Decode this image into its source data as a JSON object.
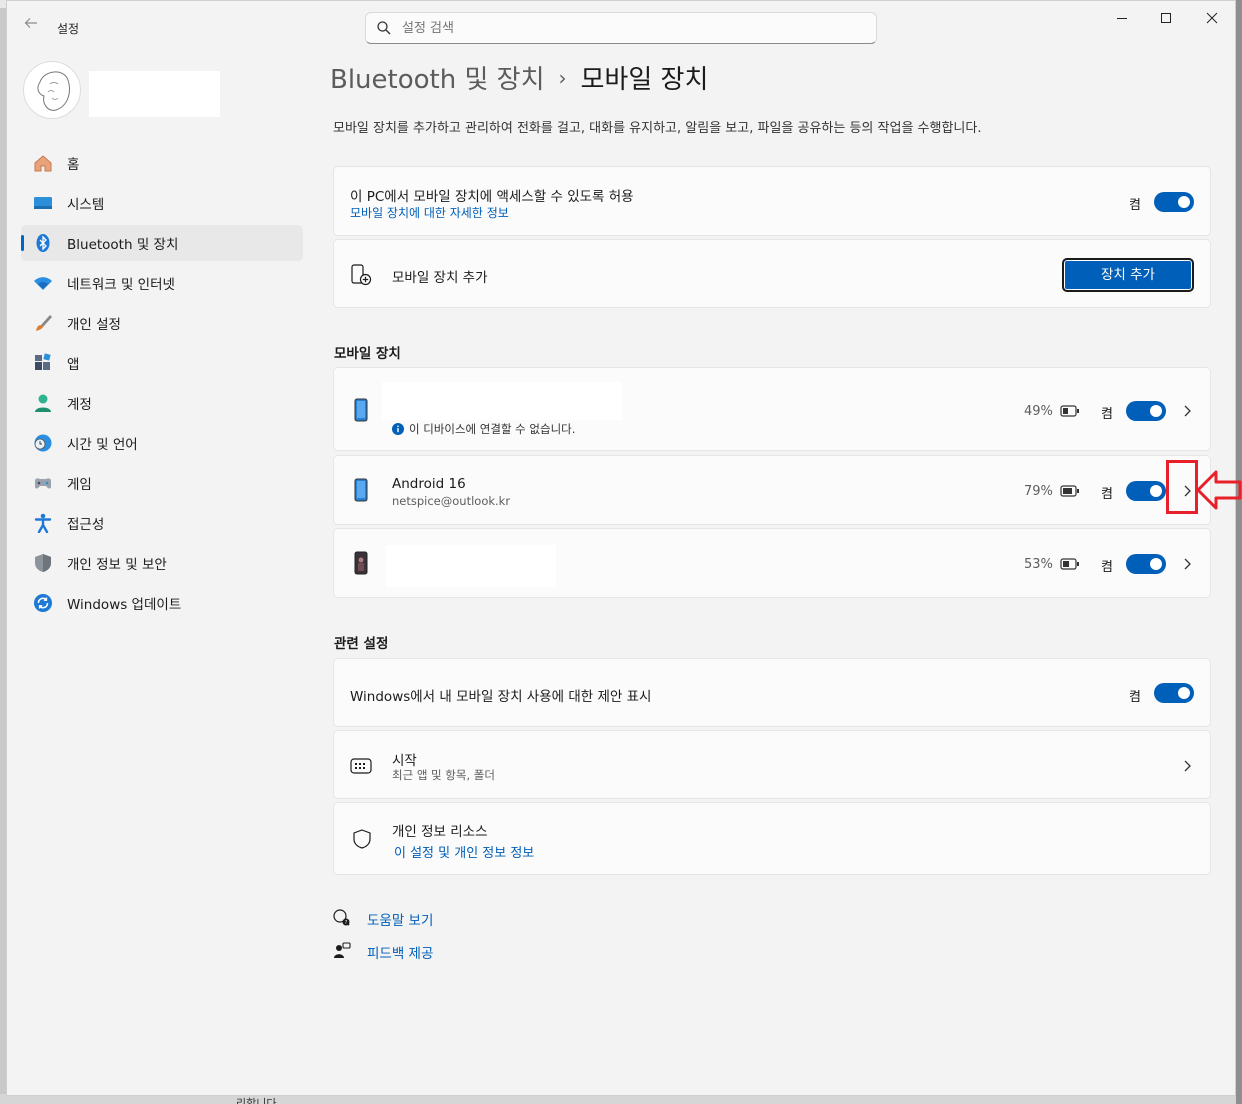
{
  "app": {
    "title": "설정",
    "search_placeholder": "설정 검색",
    "window_controls": [
      "minimize-icon",
      "maximize-icon",
      "close-icon"
    ]
  },
  "sidebar": {
    "items": [
      {
        "label": "홈",
        "icon": "home-icon"
      },
      {
        "label": "시스템",
        "icon": "system-icon"
      },
      {
        "label": "Bluetooth 및 장치",
        "icon": "bluetooth-icon",
        "active": true
      },
      {
        "label": "네트워크 및 인터넷",
        "icon": "wifi-icon"
      },
      {
        "label": "개인 설정",
        "icon": "brush-icon"
      },
      {
        "label": "앱",
        "icon": "apps-icon"
      },
      {
        "label": "계정",
        "icon": "account-icon"
      },
      {
        "label": "시간 및 언어",
        "icon": "globe-clock-icon"
      },
      {
        "label": "게임",
        "icon": "gamepad-icon"
      },
      {
        "label": "접근성",
        "icon": "accessibility-icon"
      },
      {
        "label": "개인 정보 및 보안",
        "icon": "shield-icon"
      },
      {
        "label": "Windows 업데이트",
        "icon": "update-icon"
      }
    ]
  },
  "main": {
    "breadcrumb_parent": "Bluetooth 및 장치",
    "breadcrumb_sep": "›",
    "breadcrumb_current": "모바일 장치",
    "description": "모바일 장치를 추가하고 관리하여 전화를 걸고, 대화를 유지하고, 알림을 보고, 파일을 공유하는 등의 작업을 수행합니다.",
    "allow_card": {
      "title": "이 PC에서 모바일 장치에 액세스할 수 있도록 허용",
      "link": "모바일 장치에 대한 자세한 정보",
      "toggle_label": "켬",
      "toggle_on": true
    },
    "add_card": {
      "title": "모바일 장치 추가",
      "button": "장치 추가"
    },
    "devices_heading": "모바일 장치",
    "devices": [
      {
        "name": "",
        "status": "이 디바이스에 연결할 수 없습니다.",
        "battery": "49%",
        "toggle_label": "켬",
        "toggle_on": true
      },
      {
        "name": "Android 16",
        "account": "netspice@outlook.kr",
        "battery": "79%",
        "toggle_label": "켬",
        "toggle_on": true
      },
      {
        "name": "",
        "battery": "53%",
        "toggle_label": "켬",
        "toggle_on": true
      }
    ],
    "related_heading": "관련 설정",
    "suggestions_card": {
      "title": "Windows에서 내 모바일 장치 사용에 대한 제안 표시",
      "toggle_label": "켬",
      "toggle_on": true
    },
    "start_card": {
      "title": "시작",
      "sub": "최근 앱 및 항목, 폴더"
    },
    "privacy_card": {
      "title": "개인 정보 리소스",
      "link": "이 설정 및 개인 정보 정보"
    },
    "help_link": "도움말 보기",
    "feedback_link": "피드백 제공"
  },
  "background": {
    "bottom_text": "리합니다"
  },
  "colors": {
    "accent": "#005fb8",
    "annotation": "#e8202a"
  }
}
